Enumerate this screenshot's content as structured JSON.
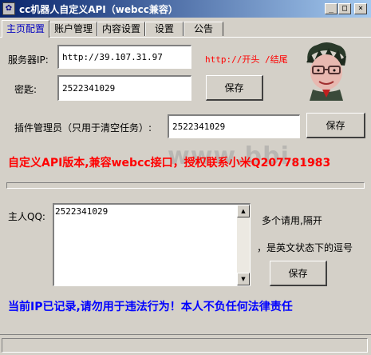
{
  "window": {
    "title": "cc机器人自定义API（webcc兼容）",
    "min_glyph": "_",
    "max_glyph": "□",
    "close_glyph": "×"
  },
  "tabs": [
    {
      "label": "主页配置",
      "active": true
    },
    {
      "label": "账户管理",
      "active": false
    },
    {
      "label": "内容设置",
      "active": false
    },
    {
      "label": "设置",
      "active": false
    },
    {
      "label": "公告",
      "active": false
    }
  ],
  "form": {
    "server_ip_label": "服务器IP:",
    "server_ip_value": "http://39.107.31.97",
    "hint_text": "http://开头  /结尾",
    "key_label": "密匙:",
    "key_value": "2522341029",
    "save_label": "保存",
    "plugin_admin_label": "插件管理员（只用于清空任务）:",
    "plugin_admin_value": "2522341029",
    "save2_label": "保存"
  },
  "notice": {
    "red_text": "自定义API版本,兼容webcc接口，授权联系小米Q207781983",
    "watermark": "www.bbi..."
  },
  "owner": {
    "label": "主人QQ:",
    "value": "2522341029",
    "help_line1": "多个请用,隔开",
    "help_line2": "，是英文状态下的逗号",
    "save_label": "保存"
  },
  "warning": {
    "blue_text": "当前IP已记录,请勿用于违法行为！本人不负任何法律责任"
  },
  "colors": {
    "title_gradient_start": "#08246b",
    "title_gradient_end": "#a5caf0",
    "red": "#ff0000",
    "blue": "#0000ff",
    "active_tab": "#0000c0"
  },
  "icons": {
    "app": "app-icon",
    "avatar": "cartoon-face-avatar"
  }
}
